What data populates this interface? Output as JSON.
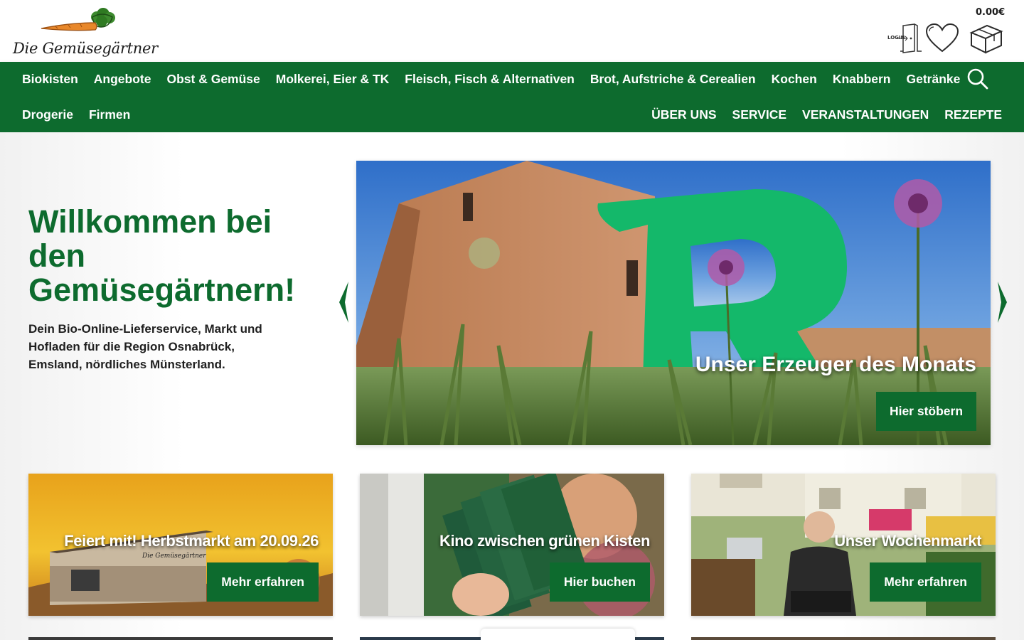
{
  "header": {
    "logo_text": "Die Gemüsegärtner",
    "cart_total": "0.00€",
    "login_label": "LOGIN"
  },
  "nav": {
    "row1": [
      "Biokisten",
      "Angebote",
      "Obst & Gemüse",
      "Molkerei, Eier & TK",
      "Fleisch, Fisch & Alternativen",
      "Brot, Aufstriche & Cerealien",
      "Kochen",
      "Knabbern",
      "Getränke"
    ],
    "row2_left": [
      "Drogerie",
      "Firmen"
    ],
    "row2_right": [
      "ÜBER UNS",
      "SERVICE",
      "VERANSTALTUNGEN",
      "REZEPTE"
    ]
  },
  "hero": {
    "title": "Willkommen bei den Gemüsegärtnern!",
    "subtitle": "Dein Bio-Online-Lieferservice, Markt und Hofladen für die Region Osnabrück, Emsland, nördliches Münsterland.",
    "slide_caption": "Unser Erzeuger des Monats",
    "slide_button": "Hier stöbern"
  },
  "tiles": [
    {
      "caption": "Feiert mit! Herbstmarkt am 20.09.26",
      "button": "Mehr erfahren",
      "sign": "Die Gemüsegärtner"
    },
    {
      "caption": "Kino zwischen grünen Kisten",
      "button": "Hier buchen"
    },
    {
      "caption": "Unser Wochenmarkt",
      "button": "Mehr erfahren"
    }
  ],
  "colors": {
    "brand_green": "#0d6b2e",
    "carrot_orange": "#e8872a"
  }
}
